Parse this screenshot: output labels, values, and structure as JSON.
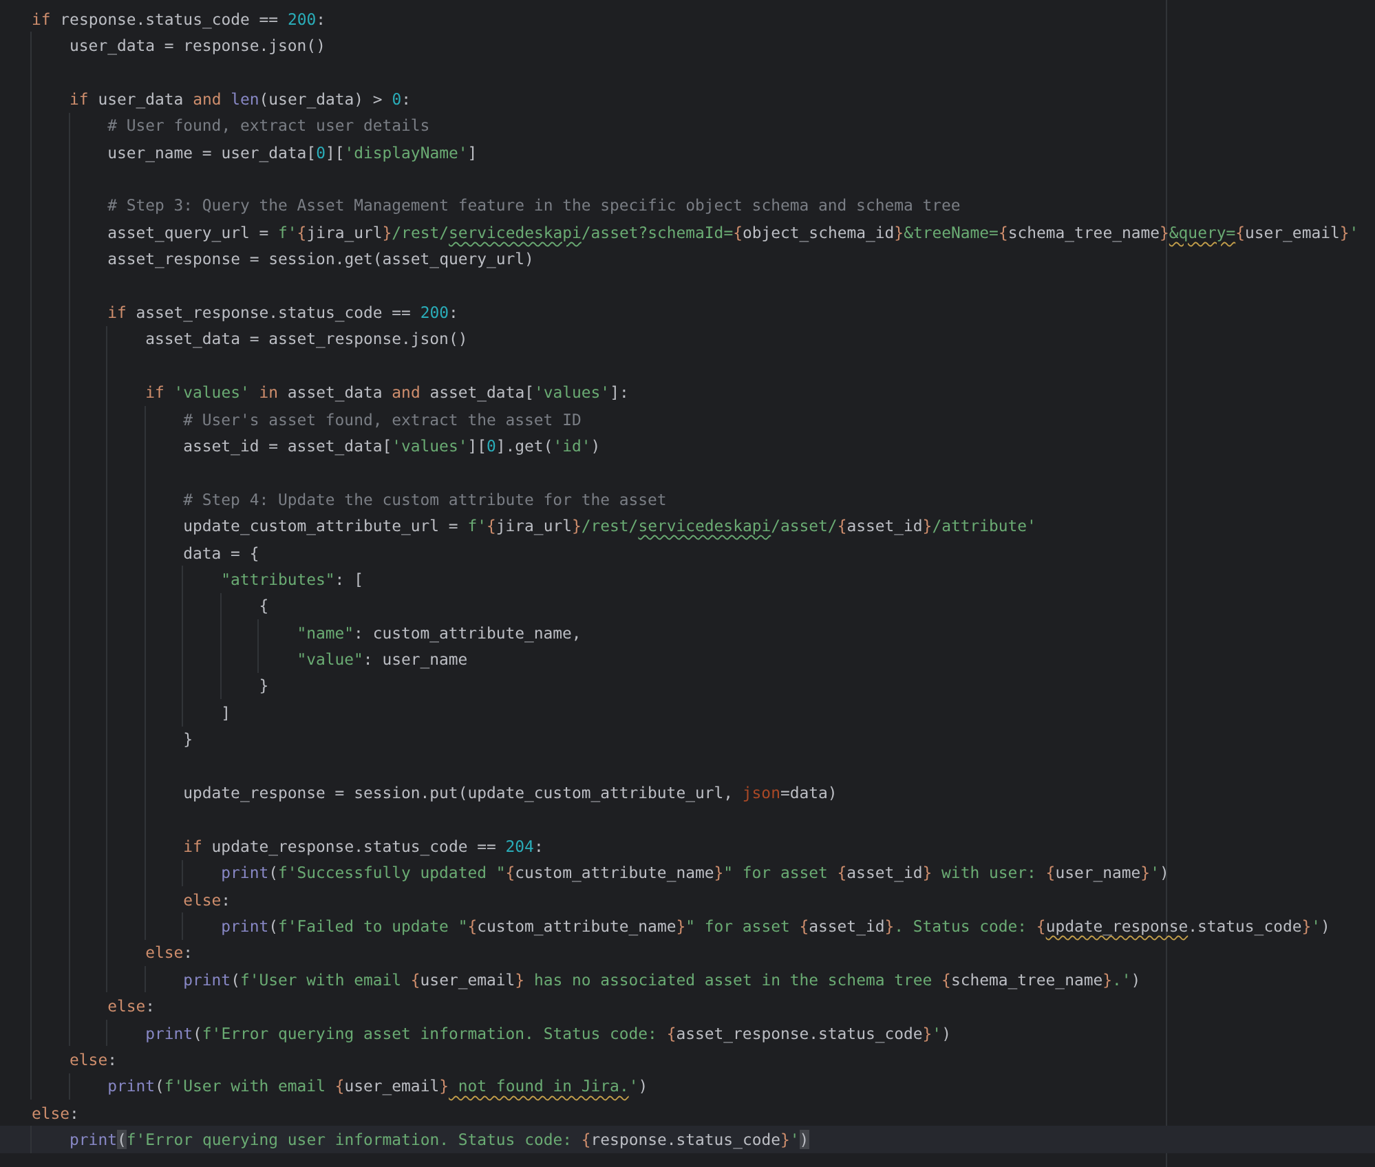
{
  "editor": {
    "lines": [
      {
        "current": false,
        "tokens": [
          {
            "kind": "keyword",
            "text": "if"
          },
          {
            "text": " response.status_code == "
          },
          {
            "kind": "number",
            "text": "200"
          },
          {
            "text": ":"
          }
        ]
      },
      {
        "current": false,
        "tokens": [
          {
            "text": "    user_data = response.json()"
          }
        ]
      },
      {
        "current": false
      },
      {
        "current": false,
        "tokens": [
          {
            "kind": "keyword",
            "text": "    if"
          },
          {
            "text": " user_data "
          },
          {
            "kind": "keyword",
            "text": "and"
          },
          {
            "kind": "builtin",
            "text": " len"
          },
          {
            "text": "(user_data) > "
          },
          {
            "kind": "number",
            "text": "0"
          },
          {
            "text": ":"
          }
        ]
      },
      {
        "current": false,
        "tokens": [
          {
            "kind": "comment",
            "text": "        # User found, extract user details"
          }
        ]
      },
      {
        "current": false,
        "tokens": [
          {
            "text": "        user_name = user_data["
          },
          {
            "kind": "number",
            "text": "0"
          },
          {
            "text": "]["
          },
          {
            "kind": "string",
            "text": "'displayName'"
          },
          {
            "text": "]"
          }
        ]
      },
      {
        "current": false
      },
      {
        "current": false,
        "tokens": [
          {
            "kind": "comment",
            "text": "        # Step 3: Query the Asset Management feature in the specific object schema and schema tree"
          }
        ]
      },
      {
        "current": false,
        "tokens": [
          {
            "text": "        asset_query_url = "
          },
          {
            "kind": "string",
            "text": "f'"
          },
          {
            "kind": "brace",
            "text": "{"
          },
          {
            "text": "jira_url"
          },
          {
            "kind": "brace",
            "text": "}"
          },
          {
            "kind": "string",
            "text": "/rest/"
          },
          {
            "kind": "string-typo",
            "text": "servicedeskapi"
          },
          {
            "kind": "string",
            "text": "/asset?schemaId="
          },
          {
            "kind": "brace",
            "text": "{"
          },
          {
            "text": "object_schema_id"
          },
          {
            "kind": "brace",
            "text": "}"
          },
          {
            "kind": "string",
            "text": "&treeName="
          },
          {
            "kind": "brace",
            "text": "{"
          },
          {
            "text": "schema_tree_name"
          },
          {
            "kind": "brace",
            "text": "}"
          },
          {
            "kind": "string-warning",
            "text": "&query="
          },
          {
            "kind": "brace",
            "text": "{"
          },
          {
            "text": "user_email"
          },
          {
            "kind": "brace",
            "text": "}"
          },
          {
            "kind": "string",
            "text": "'"
          }
        ]
      },
      {
        "current": false,
        "tokens": [
          {
            "text": "        asset_response = session.get(asset_query_url)"
          }
        ]
      },
      {
        "current": false
      },
      {
        "current": false,
        "tokens": [
          {
            "kind": "keyword",
            "text": "        if"
          },
          {
            "text": " asset_response.status_code == "
          },
          {
            "kind": "number",
            "text": "200"
          },
          {
            "text": ":"
          }
        ]
      },
      {
        "current": false,
        "tokens": [
          {
            "text": "            asset_data = asset_response.json()"
          }
        ]
      },
      {
        "current": false
      },
      {
        "current": false,
        "tokens": [
          {
            "kind": "keyword",
            "text": "            if"
          },
          {
            "kind": "string",
            "text": " 'values'"
          },
          {
            "kind": "keyword",
            "text": " in"
          },
          {
            "text": " asset_data "
          },
          {
            "kind": "keyword",
            "text": "and"
          },
          {
            "text": " asset_data["
          },
          {
            "kind": "string",
            "text": "'values'"
          },
          {
            "text": "]:"
          }
        ]
      },
      {
        "current": false,
        "tokens": [
          {
            "kind": "comment",
            "text": "                # User's asset found, extract the asset ID"
          }
        ]
      },
      {
        "current": false,
        "tokens": [
          {
            "text": "                asset_id = asset_data["
          },
          {
            "kind": "string",
            "text": "'values'"
          },
          {
            "text": "]["
          },
          {
            "kind": "number",
            "text": "0"
          },
          {
            "text": "].get("
          },
          {
            "kind": "string",
            "text": "'id'"
          },
          {
            "text": ")"
          }
        ]
      },
      {
        "current": false
      },
      {
        "current": false,
        "tokens": [
          {
            "kind": "comment",
            "text": "                # Step 4: Update the custom attribute for the asset"
          }
        ]
      },
      {
        "current": false,
        "tokens": [
          {
            "text": "                update_custom_attribute_url = "
          },
          {
            "kind": "string",
            "text": "f'"
          },
          {
            "kind": "brace",
            "text": "{"
          },
          {
            "text": "jira_url"
          },
          {
            "kind": "brace",
            "text": "}"
          },
          {
            "kind": "string",
            "text": "/rest/"
          },
          {
            "kind": "string-typo",
            "text": "servicedeskapi"
          },
          {
            "kind": "string",
            "text": "/asset/"
          },
          {
            "kind": "brace",
            "text": "{"
          },
          {
            "text": "asset_id"
          },
          {
            "kind": "brace",
            "text": "}"
          },
          {
            "kind": "string",
            "text": "/attribute'"
          }
        ]
      },
      {
        "current": false,
        "tokens": [
          {
            "text": "                data = {"
          }
        ]
      },
      {
        "current": false,
        "tokens": [
          {
            "kind": "string",
            "text": "                    \"attributes\""
          },
          {
            "text": ": ["
          }
        ]
      },
      {
        "current": false,
        "tokens": [
          {
            "text": "                        {"
          }
        ]
      },
      {
        "current": false,
        "tokens": [
          {
            "kind": "string",
            "text": "                            \"name\""
          },
          {
            "text": ": custom_attribute_name,"
          }
        ]
      },
      {
        "current": false,
        "tokens": [
          {
            "kind": "string",
            "text": "                            \"value\""
          },
          {
            "text": ": user_name"
          }
        ]
      },
      {
        "current": false,
        "tokens": [
          {
            "text": "                        }"
          }
        ]
      },
      {
        "current": false,
        "tokens": [
          {
            "text": "                    ]"
          }
        ]
      },
      {
        "current": false,
        "tokens": [
          {
            "text": "                }"
          }
        ]
      },
      {
        "current": false
      },
      {
        "current": false,
        "tokens": [
          {
            "text": "                update_response = session.put(update_custom_attribute_url, "
          },
          {
            "kind": "kwarg",
            "text": "json"
          },
          {
            "text": "=data)"
          }
        ]
      },
      {
        "current": false
      },
      {
        "current": false,
        "tokens": [
          {
            "kind": "keyword",
            "text": "                if"
          },
          {
            "text": " update_response.status_code == "
          },
          {
            "kind": "number",
            "text": "204"
          },
          {
            "text": ":"
          }
        ]
      },
      {
        "current": false,
        "tokens": [
          {
            "kind": "builtin",
            "text": "                    print"
          },
          {
            "text": "("
          },
          {
            "kind": "string",
            "text": "f'Successfully updated \""
          },
          {
            "kind": "brace",
            "text": "{"
          },
          {
            "text": "custom_attribute_name"
          },
          {
            "kind": "brace",
            "text": "}"
          },
          {
            "kind": "string",
            "text": "\" for asset "
          },
          {
            "kind": "brace",
            "text": "{"
          },
          {
            "text": "asset_id"
          },
          {
            "kind": "brace",
            "text": "}"
          },
          {
            "kind": "string",
            "text": " with user: "
          },
          {
            "kind": "brace",
            "text": "{"
          },
          {
            "text": "user_name"
          },
          {
            "kind": "brace",
            "text": "}"
          },
          {
            "kind": "string",
            "text": "'"
          },
          {
            "text": ")"
          }
        ]
      },
      {
        "current": false,
        "tokens": [
          {
            "kind": "keyword",
            "text": "                else"
          },
          {
            "text": ":"
          }
        ]
      },
      {
        "current": false,
        "tokens": [
          {
            "kind": "builtin",
            "text": "                    print"
          },
          {
            "text": "("
          },
          {
            "kind": "string",
            "text": "f'Failed to update \""
          },
          {
            "kind": "brace",
            "text": "{"
          },
          {
            "text": "custom_attribute_name"
          },
          {
            "kind": "brace",
            "text": "}"
          },
          {
            "kind": "string",
            "text": "\" for asset "
          },
          {
            "kind": "brace",
            "text": "{"
          },
          {
            "text": "asset_id"
          },
          {
            "kind": "brace",
            "text": "}"
          },
          {
            "kind": "string",
            "text": ". Status code: "
          },
          {
            "kind": "brace",
            "text": "{"
          },
          {
            "kind": "warning",
            "text": "update_response"
          },
          {
            "text": ".status_code"
          },
          {
            "kind": "brace",
            "text": "}"
          },
          {
            "kind": "string",
            "text": "'"
          },
          {
            "text": ")"
          }
        ]
      },
      {
        "current": false,
        "tokens": [
          {
            "kind": "keyword",
            "text": "            else"
          },
          {
            "text": ":"
          }
        ]
      },
      {
        "current": false,
        "tokens": [
          {
            "kind": "builtin",
            "text": "                print"
          },
          {
            "text": "("
          },
          {
            "kind": "string",
            "text": "f'User with email "
          },
          {
            "kind": "brace",
            "text": "{"
          },
          {
            "text": "user_email"
          },
          {
            "kind": "brace",
            "text": "}"
          },
          {
            "kind": "string",
            "text": " has no associated asset in the schema tree "
          },
          {
            "kind": "brace",
            "text": "{"
          },
          {
            "text": "schema_tree_name"
          },
          {
            "kind": "brace",
            "text": "}"
          },
          {
            "kind": "string",
            "text": ".'"
          },
          {
            "text": ")"
          }
        ]
      },
      {
        "current": false,
        "tokens": [
          {
            "kind": "keyword",
            "text": "        else"
          },
          {
            "text": ":"
          }
        ]
      },
      {
        "current": false,
        "tokens": [
          {
            "kind": "builtin",
            "text": "            print"
          },
          {
            "text": "("
          },
          {
            "kind": "string",
            "text": "f'Error querying asset information. Status code: "
          },
          {
            "kind": "brace",
            "text": "{"
          },
          {
            "text": "asset_response.status_code"
          },
          {
            "kind": "brace",
            "text": "}"
          },
          {
            "kind": "string",
            "text": "'"
          },
          {
            "text": ")"
          }
        ]
      },
      {
        "current": false,
        "tokens": [
          {
            "kind": "keyword",
            "text": "    else"
          },
          {
            "text": ":"
          }
        ]
      },
      {
        "current": false,
        "tokens": [
          {
            "kind": "builtin",
            "text": "        print"
          },
          {
            "text": "("
          },
          {
            "kind": "string",
            "text": "f'User with email "
          },
          {
            "kind": "brace",
            "text": "{"
          },
          {
            "text": "user_email"
          },
          {
            "kind": "brace",
            "text": "}"
          },
          {
            "kind": "string-warning",
            "text": " not found in Jira."
          },
          {
            "kind": "string",
            "text": "'"
          },
          {
            "text": ")"
          }
        ]
      },
      {
        "current": false,
        "tokens": [
          {
            "kind": "keyword",
            "text": "else"
          },
          {
            "text": ":"
          }
        ]
      },
      {
        "current": true,
        "tokens": [
          {
            "kind": "builtin",
            "text": "    print"
          },
          {
            "kind": "paren-match",
            "text": "("
          },
          {
            "kind": "string",
            "text": "f'Error querying user information. Status code: "
          },
          {
            "kind": "brace",
            "text": "{"
          },
          {
            "text": "response.status_code"
          },
          {
            "kind": "brace",
            "text": "}"
          },
          {
            "kind": "string",
            "text": "'"
          },
          {
            "kind": "paren-match",
            "text": ")"
          }
        ]
      }
    ]
  }
}
